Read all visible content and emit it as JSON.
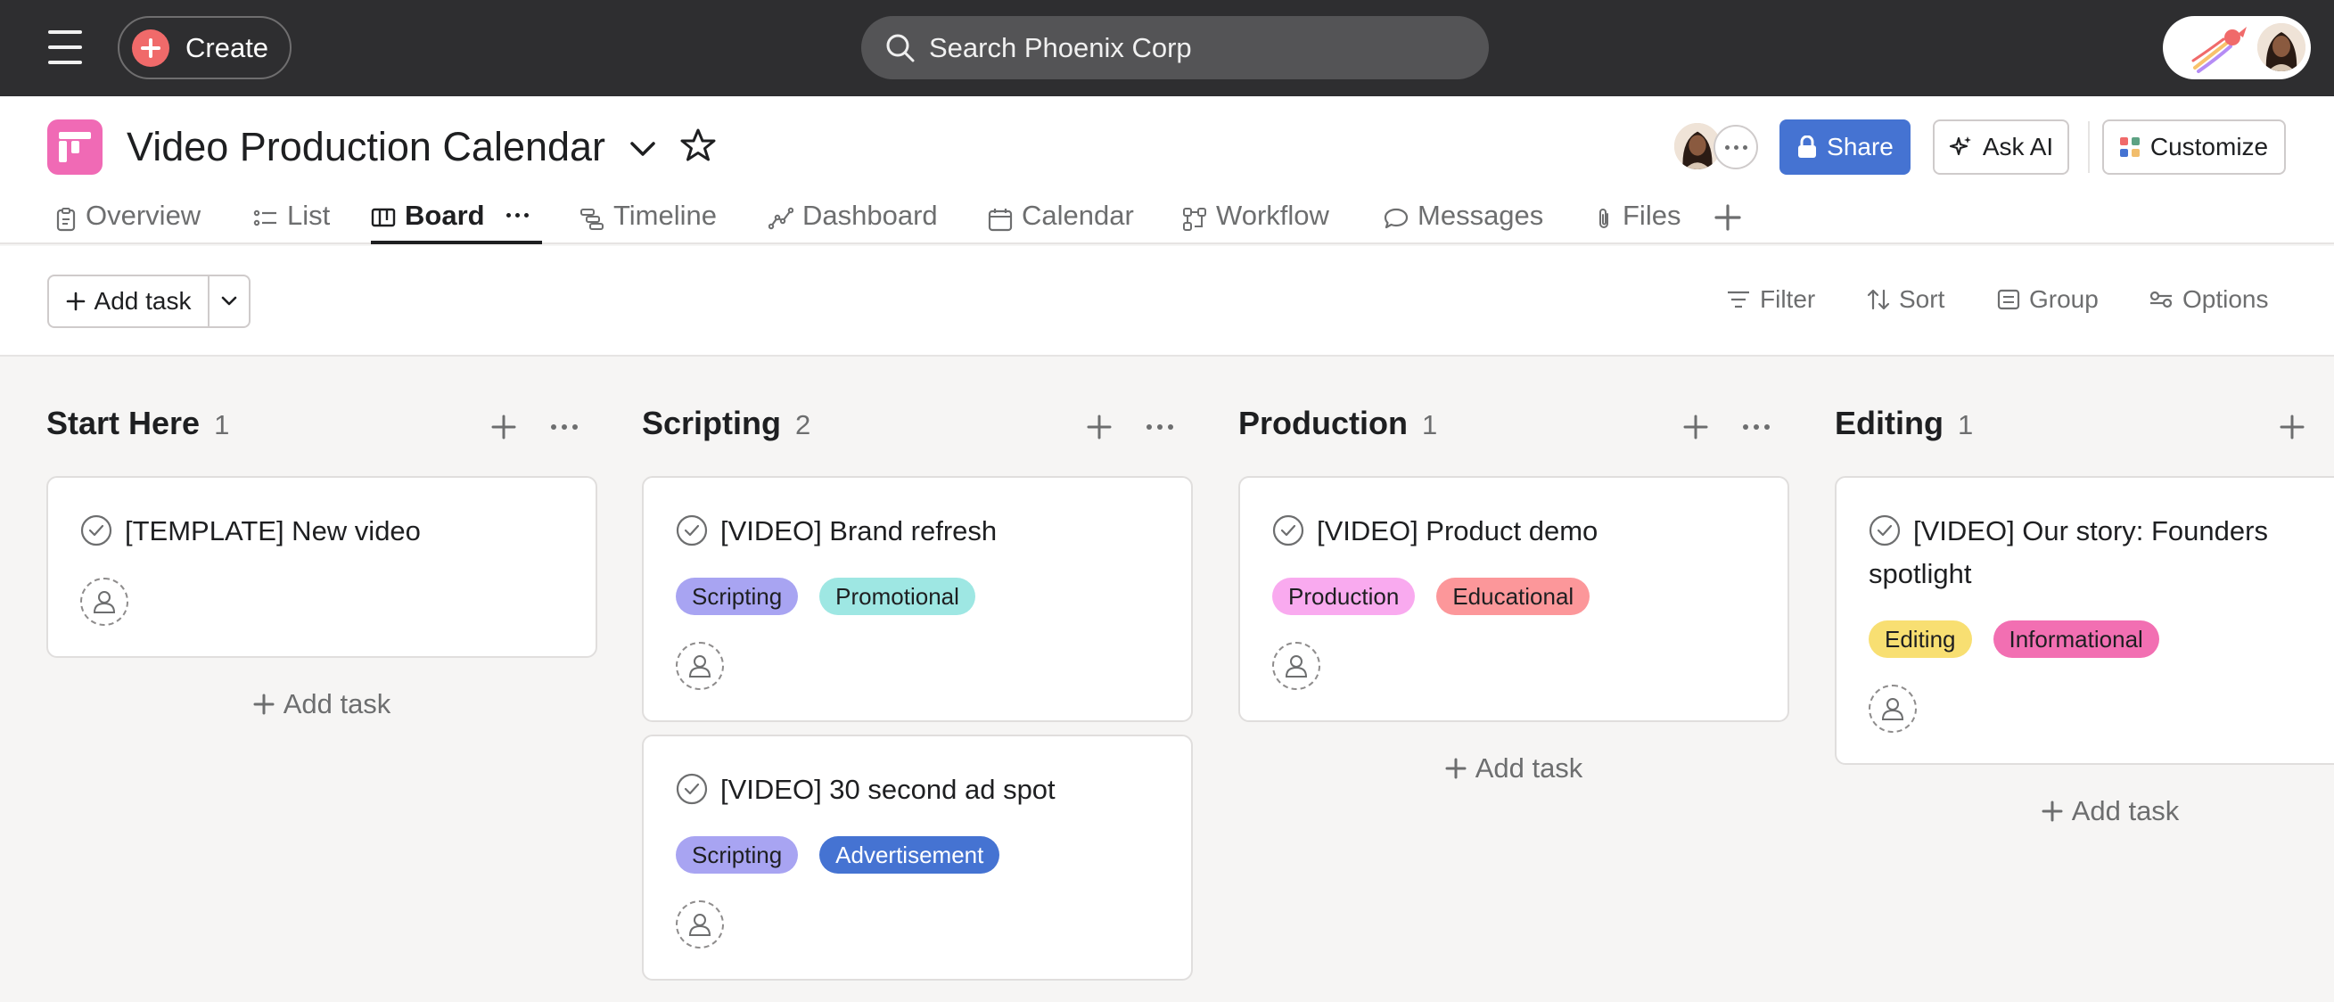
{
  "topbar": {
    "create_label": "Create",
    "search_placeholder": "Search Phoenix Corp"
  },
  "project": {
    "title": "Video Production Calendar",
    "share_label": "Share",
    "ask_ai_label": "Ask AI",
    "customize_label": "Customize",
    "icon_color": "#f06ab5",
    "share_color": "#4573d2"
  },
  "tabs": [
    {
      "label": "Overview",
      "icon": "clipboard-icon"
    },
    {
      "label": "List",
      "icon": "list-icon"
    },
    {
      "label": "Board",
      "icon": "board-icon",
      "active": true
    },
    {
      "label": "Timeline",
      "icon": "timeline-icon"
    },
    {
      "label": "Dashboard",
      "icon": "dashboard-icon"
    },
    {
      "label": "Calendar",
      "icon": "calendar-icon"
    },
    {
      "label": "Workflow",
      "icon": "workflow-icon"
    },
    {
      "label": "Messages",
      "icon": "message-icon"
    },
    {
      "label": "Files",
      "icon": "paperclip-icon"
    }
  ],
  "toolbar": {
    "add_task_label": "Add task",
    "filter_label": "Filter",
    "sort_label": "Sort",
    "group_label": "Group",
    "options_label": "Options"
  },
  "columns": [
    {
      "name": "Start Here",
      "count": "1",
      "add_task_label": "Add task",
      "cards": [
        {
          "title": "[TEMPLATE] New video",
          "tags": []
        }
      ]
    },
    {
      "name": "Scripting",
      "count": "2",
      "add_task_label": "Add task",
      "cards": [
        {
          "title": "[VIDEO] Brand refresh",
          "tags": [
            {
              "label": "Scripting",
              "bg": "#a8a4f2",
              "fg": "#1e1f21"
            },
            {
              "label": "Promotional",
              "bg": "#9ee7e3",
              "fg": "#1e1f21"
            }
          ]
        },
        {
          "title": "[VIDEO] 30 second ad spot",
          "tags": [
            {
              "label": "Scripting",
              "bg": "#a8a4f2",
              "fg": "#1e1f21"
            },
            {
              "label": "Advertisement",
              "bg": "#4573d2",
              "fg": "#ffffff"
            }
          ]
        }
      ]
    },
    {
      "name": "Production",
      "count": "1",
      "add_task_label": "Add task",
      "cards": [
        {
          "title": "[VIDEO] Product demo",
          "tags": [
            {
              "label": "Production",
              "bg": "#f9aaef",
              "fg": "#1e1f21"
            },
            {
              "label": "Educational",
              "bg": "#fc979a",
              "fg": "#1e1f21"
            }
          ]
        }
      ]
    },
    {
      "name": "Editing",
      "count": "1",
      "add_task_label": "Add task",
      "cards": [
        {
          "title": "[VIDEO] Our story: Founders spotlight",
          "tags": [
            {
              "label": "Editing",
              "bg": "#f8df72",
              "fg": "#1e1f21"
            },
            {
              "label": "Informational",
              "bg": "#f26fb2",
              "fg": "#1e1f21"
            }
          ]
        }
      ]
    }
  ]
}
